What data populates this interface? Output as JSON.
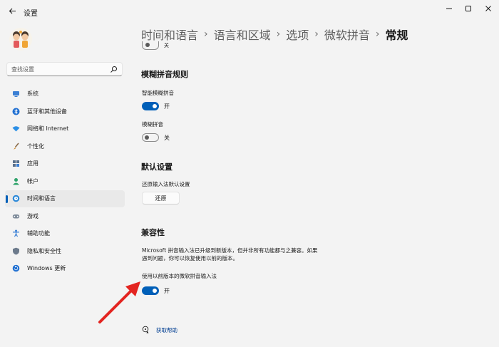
{
  "app": {
    "title": "设置"
  },
  "search": {
    "placeholder": "查找设置"
  },
  "sidebar": {
    "items": [
      {
        "label": "系统",
        "icon": "monitor-icon"
      },
      {
        "label": "蓝牙和其他设备",
        "icon": "bluetooth-icon"
      },
      {
        "label": "网络和 Internet",
        "icon": "wifi-icon"
      },
      {
        "label": "个性化",
        "icon": "brush-icon"
      },
      {
        "label": "应用",
        "icon": "apps-icon"
      },
      {
        "label": "帐户",
        "icon": "person-icon"
      },
      {
        "label": "时间和语言",
        "icon": "globe-clock-icon",
        "selected": true
      },
      {
        "label": "游戏",
        "icon": "gamepad-icon"
      },
      {
        "label": "辅助功能",
        "icon": "accessibility-icon"
      },
      {
        "label": "隐私和安全性",
        "icon": "shield-icon"
      },
      {
        "label": "Windows 更新",
        "icon": "update-icon"
      }
    ]
  },
  "breadcrumb": {
    "items": [
      "时间和语言",
      "语言和区域",
      "选项",
      "微软拼音"
    ],
    "current": "常规"
  },
  "partial": {
    "state": "关"
  },
  "fuzzy": {
    "title": "模糊拼音规则",
    "smart_label": "智能模糊拼音",
    "smart_state": "开",
    "fuzzy_label": "模糊拼音",
    "fuzzy_state": "关"
  },
  "defaults": {
    "title": "默认设置",
    "restore_label": "还原输入法默认设置",
    "restore_button": "还原"
  },
  "compat": {
    "title": "兼容性",
    "description": "Microsoft 拼音输入法已升级到新版本，但并非所有功能都与之兼容。如果遇到问题，你可以恢复使用以前的版本。",
    "legacy_label": "使用以前版本的微软拼音输入法",
    "legacy_state": "开"
  },
  "help": {
    "label": "获取帮助"
  },
  "colors": {
    "accent": "#005fb8",
    "annotation_arrow": "#e32420"
  }
}
